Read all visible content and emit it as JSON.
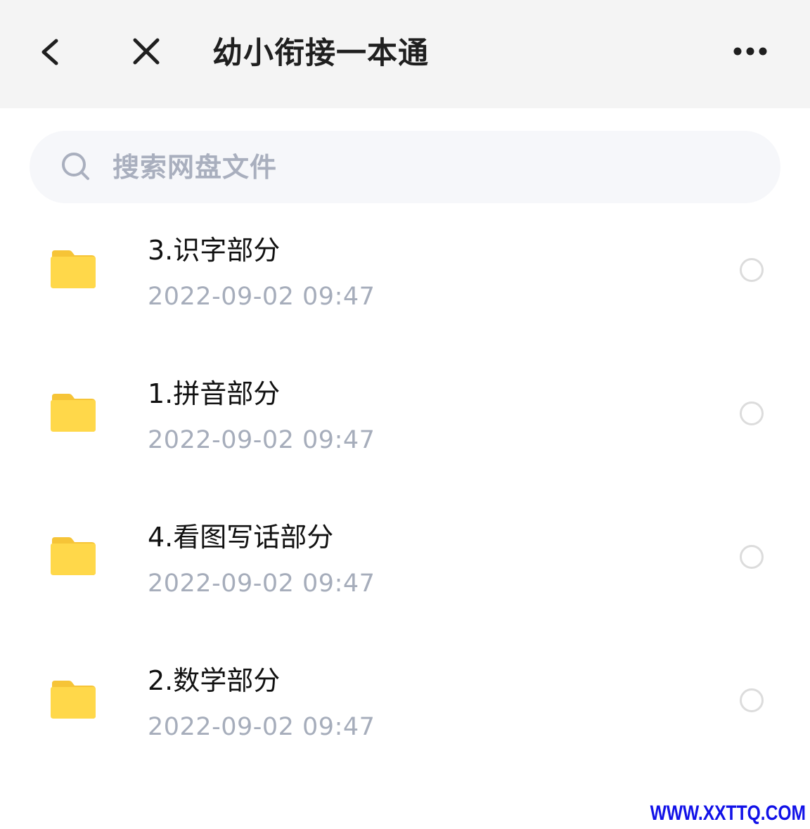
{
  "header": {
    "title": "幼小衔接一本通",
    "back_icon": "chevron-left-icon",
    "close_icon": "close-icon",
    "more_icon": "more-horizontal-icon"
  },
  "search": {
    "placeholder": "搜索网盘文件",
    "icon": "search-icon"
  },
  "files": [
    {
      "name": "3.识字部分",
      "date": "2022-09-02  09:47",
      "icon": "folder-icon",
      "selected": false
    },
    {
      "name": "1.拼音部分",
      "date": "2022-09-02  09:47",
      "icon": "folder-icon",
      "selected": false
    },
    {
      "name": "4.看图写话部分",
      "date": "2022-09-02  09:47",
      "icon": "folder-icon",
      "selected": false
    },
    {
      "name": "2.数学部分",
      "date": "2022-09-02  09:47",
      "icon": "folder-icon",
      "selected": false
    }
  ],
  "watermark": "WWW.XXTTQ.COM",
  "colors": {
    "header_bg": "#f4f4f4",
    "folder": "#ffd84a",
    "folder_tab": "#f6c437",
    "date_text": "#a6adbb",
    "watermark": "#1212e8"
  }
}
